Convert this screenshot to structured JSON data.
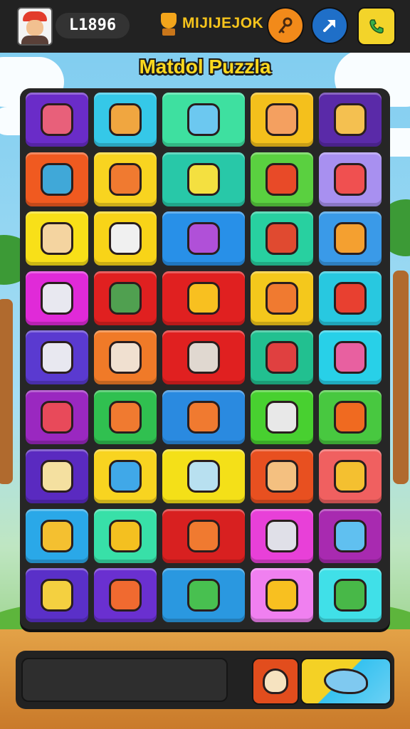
{
  "header": {
    "score": "L1896",
    "brand": "MIJIJEJOK",
    "icons": {
      "avatar": "player-avatar",
      "trophy": "trophy-icon",
      "key": "key-icon",
      "share": "share-arrow-icon",
      "phone": "phone-icon"
    },
    "colors": {
      "key_btn": "#f28a1a",
      "share_btn": "#1f6fc8",
      "phone_btn": "#f3d42a",
      "brand": "#f6c41c"
    }
  },
  "title": "Matdol Puzzla",
  "board": {
    "rows": [
      {
        "tiles": [
          {
            "color": "#6a2cc8",
            "icon": "ping-pong-paddle-icon",
            "ic": "#e8607a"
          },
          {
            "color": "#35c8e8",
            "icon": "cup-icon",
            "ic": "#f0a640"
          },
          {
            "color": "#3ee0a0",
            "icon": "gamepad-icon",
            "ic": "#6cc8f0"
          },
          {
            "color": "#f4c01c",
            "icon": "jar-icon",
            "ic": "#f4a060"
          },
          {
            "color": "#5a2aa8",
            "icon": "popsicle-icon",
            "ic": "#f4c050"
          }
        ]
      },
      {
        "tiles": [
          {
            "color": "#f05a20",
            "icon": "radio-icon",
            "ic": "#40a8d8"
          },
          {
            "color": "#f8d420",
            "icon": "gear-icon",
            "ic": "#f07a30"
          },
          {
            "color": "#28c8a8",
            "icon": "gamepad-icon",
            "ic": "#f4e040"
          },
          {
            "color": "#5ad040",
            "icon": "bowl-icon",
            "ic": "#e84a28"
          },
          {
            "color": "#a890f0",
            "icon": "gamepad-icon",
            "ic": "#f05050"
          }
        ]
      },
      {
        "tiles": [
          {
            "color": "#f8e018",
            "icon": "face-icon",
            "ic": "#f4d4a0"
          },
          {
            "color": "#f8d418",
            "icon": "note-icon",
            "ic": "#f0f0f0"
          },
          {
            "color": "#2890e8",
            "icon": "hippo-icon",
            "ic": "#b050d8"
          },
          {
            "color": "#28d0a0",
            "icon": "chopsticks-icon",
            "ic": "#e04a30"
          },
          {
            "color": "#3a9ae8",
            "icon": "candy-icon",
            "ic": "#f4a030"
          }
        ]
      },
      {
        "tiles": [
          {
            "color": "#e02ad8",
            "icon": "robot-icon",
            "ic": "#e8e8f0"
          },
          {
            "color": "#e02020",
            "icon": "monster-icon",
            "ic": "#50a050"
          },
          {
            "color": "#e02020",
            "icon": "magnifier-icon",
            "ic": "#f8c020"
          },
          {
            "color": "#f4c81c",
            "icon": "crab-icon",
            "ic": "#f07a30"
          },
          {
            "color": "#28c8e0",
            "icon": "bottle-icon",
            "ic": "#e84030"
          }
        ]
      },
      {
        "tiles": [
          {
            "color": "#5a3ad0",
            "icon": "gamepad-icon",
            "ic": "#e8e8f0"
          },
          {
            "color": "#f07a28",
            "icon": "bone-icon",
            "ic": "#f0e0d0"
          },
          {
            "color": "#e02020",
            "icon": "bear-icon",
            "ic": "#e0d8d0"
          },
          {
            "color": "#22c090",
            "icon": "vase-icon",
            "ic": "#e04040"
          },
          {
            "color": "#28d0e8",
            "icon": "ping-pong-paddle-icon",
            "ic": "#e860a0"
          }
        ]
      },
      {
        "tiles": [
          {
            "color": "#9a28c0",
            "icon": "gamepad-icon",
            "ic": "#e84a5a"
          },
          {
            "color": "#30c050",
            "icon": "bear-icon",
            "ic": "#f07a30"
          },
          {
            "color": "#2a8ae0",
            "icon": "hippo-icon",
            "ic": "#f07a30"
          },
          {
            "color": "#48d030",
            "icon": "lamp-icon",
            "ic": "#e8e8e8"
          },
          {
            "color": "#48c840",
            "icon": "sun-icon",
            "ic": "#f06a20"
          }
        ]
      },
      {
        "tiles": [
          {
            "color": "#5a2ac0",
            "icon": "rattle-icon",
            "ic": "#f4e0a0"
          },
          {
            "color": "#f8d420",
            "icon": "wand-icon",
            "ic": "#40a8e8"
          },
          {
            "color": "#f4e018",
            "icon": "dog-icon",
            "ic": "#b8e0f0"
          },
          {
            "color": "#e85020",
            "icon": "note-slash-icon",
            "ic": "#f4c080"
          },
          {
            "color": "#f06060",
            "icon": "leaf-icon",
            "ic": "#f4c030"
          }
        ]
      },
      {
        "tiles": [
          {
            "color": "#2aa8e8",
            "icon": "box-icon",
            "ic": "#f4c030"
          },
          {
            "color": "#38e0a8",
            "icon": "balloon-icon",
            "ic": "#f4c020"
          },
          {
            "color": "#d82020",
            "icon": "bear-icon",
            "ic": "#f07a30"
          },
          {
            "color": "#e840d8",
            "icon": "robot-icon",
            "ic": "#e0e0e8"
          },
          {
            "color": "#a82ab0",
            "icon": "pencil-icon",
            "ic": "#60c0f0"
          }
        ]
      },
      {
        "tiles": [
          {
            "color": "#5a30c8",
            "icon": "gamepad-icon",
            "ic": "#f4d040"
          },
          {
            "color": "#6a30d0",
            "icon": "carrot-icon",
            "ic": "#f06a30"
          },
          {
            "color": "#2a98e0",
            "icon": "hippo-icon",
            "ic": "#48c050"
          },
          {
            "color": "#f080f0",
            "icon": "magnifier-icon",
            "ic": "#f8c020"
          },
          {
            "color": "#40e0e8",
            "icon": "bandage-icon",
            "ic": "#48b848"
          }
        ]
      }
    ]
  },
  "footer": {
    "message": "",
    "hint_icon": "ghost-icon",
    "action_icon": "bird-icon",
    "colors": {
      "hint_btn": "#e24d1d"
    }
  }
}
